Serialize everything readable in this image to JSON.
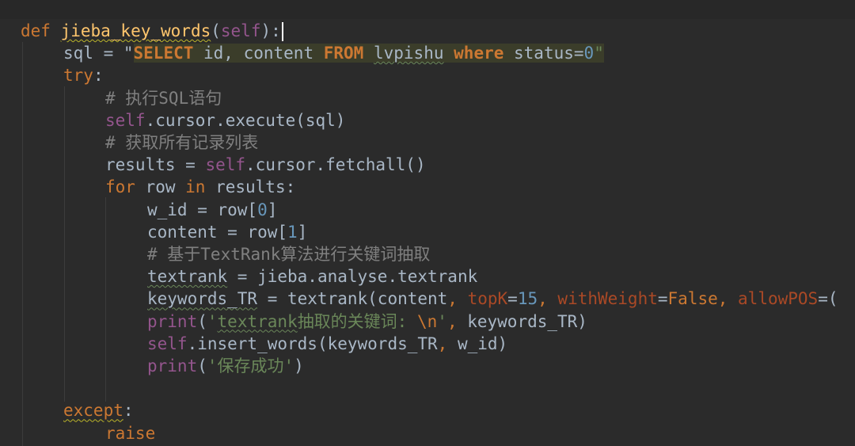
{
  "editor": {
    "lines": [
      {
        "t": [
          [
            "kw",
            "def "
          ],
          [
            "fn",
            "jieba_key_words"
          ],
          [
            "p",
            "("
          ],
          [
            "self",
            "self"
          ],
          [
            "p",
            "):"
          ]
        ]
      },
      {
        "t": [
          [
            "p",
            "sql = \""
          ],
          [
            "sqlkw",
            "SELECT"
          ],
          [
            "p",
            " id, content "
          ],
          [
            "sqlkw",
            "FROM"
          ],
          [
            "p",
            " lvpishu "
          ],
          [
            "sqlkw",
            "where"
          ],
          [
            "p",
            " status="
          ],
          [
            "num",
            "0"
          ],
          [
            "str",
            "\""
          ]
        ]
      },
      {
        "t": [
          [
            "kw",
            "try"
          ],
          [
            "p",
            ":"
          ]
        ]
      },
      {
        "t": [
          [
            "cmt",
            "# 执行SQL语句"
          ]
        ]
      },
      {
        "t": [
          [
            "self",
            "self"
          ],
          [
            "p",
            ".cursor.execute(sql)"
          ]
        ]
      },
      {
        "t": [
          [
            "cmt",
            "# 获取所有记录列表"
          ]
        ]
      },
      {
        "t": [
          [
            "p",
            "results = "
          ],
          [
            "self",
            "self"
          ],
          [
            "p",
            ".cursor.fetchall()"
          ]
        ]
      },
      {
        "t": [
          [
            "kw",
            "for"
          ],
          [
            "p",
            " row "
          ],
          [
            "kw",
            "in"
          ],
          [
            "p",
            " results:"
          ]
        ]
      },
      {
        "t": [
          [
            "p",
            "w_id = row["
          ],
          [
            "num",
            "0"
          ],
          [
            "p",
            "]"
          ]
        ]
      },
      {
        "t": [
          [
            "p",
            "content = row["
          ],
          [
            "num",
            "1"
          ],
          [
            "p",
            "]"
          ]
        ]
      },
      {
        "t": [
          [
            "cmt",
            "# 基于TextRank算法进行关键词抽取"
          ]
        ]
      },
      {
        "t": [
          [
            "p",
            "textrank = jieba.analyse.textrank"
          ]
        ]
      },
      {
        "t": [
          [
            "p",
            "keywords_TR = textrank(content"
          ],
          [
            "kw",
            ", "
          ],
          [
            "param",
            "topK"
          ],
          [
            "p",
            "="
          ],
          [
            "num",
            "15"
          ],
          [
            "kw",
            ", "
          ],
          [
            "param",
            "withWeight"
          ],
          [
            "p",
            "="
          ],
          [
            "kw",
            "False"
          ],
          [
            "kw",
            ", "
          ],
          [
            "param",
            "allowPOS"
          ],
          [
            "p",
            "=("
          ]
        ]
      },
      {
        "t": [
          [
            "self",
            "print"
          ],
          [
            "p",
            "("
          ],
          [
            "str",
            "'textrank抽取的关键词: "
          ],
          [
            "esc",
            "\\n"
          ],
          [
            "str",
            "'"
          ],
          [
            "kw",
            ", "
          ],
          [
            "p",
            "keywords_TR)"
          ]
        ]
      },
      {
        "t": [
          [
            "self",
            "self"
          ],
          [
            "p",
            ".insert_words(keywords_TR"
          ],
          [
            "kw",
            ", "
          ],
          [
            "p",
            "w_id)"
          ]
        ]
      },
      {
        "t": [
          [
            "self",
            "print"
          ],
          [
            "p",
            "("
          ],
          [
            "str",
            "'保存成功'"
          ],
          [
            "p",
            ")"
          ]
        ]
      },
      {
        "t": []
      },
      {
        "t": [
          [
            "kw",
            "except"
          ],
          [
            "p",
            ":"
          ]
        ]
      },
      {
        "t": [
          [
            "kw",
            "raise"
          ]
        ]
      }
    ],
    "colors": {
      "background": "#2b2b2b",
      "keyword": "#cc7832",
      "self": "#94558d",
      "number": "#6897bb",
      "string": "#6a8759",
      "comment": "#808080",
      "default": "#a9b7c6"
    }
  }
}
